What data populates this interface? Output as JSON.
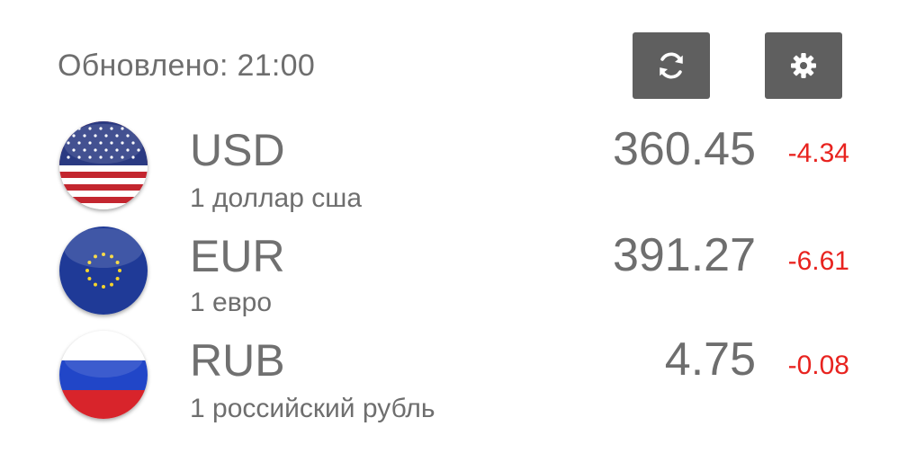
{
  "header": {
    "updated_text": "Обновлено: 21:00",
    "refresh_icon": "refresh-icon",
    "settings_icon": "gear-icon"
  },
  "colors": {
    "button_bg": "#5f5f5f",
    "negative": "#e8231f",
    "text": "#6e6e6e"
  },
  "currencies": [
    {
      "code": "USD",
      "description": "1 доллар сша",
      "rate": "360.45",
      "change": "-4.34",
      "flag": "us-flag-icon"
    },
    {
      "code": "EUR",
      "description": "1 евро",
      "rate": "391.27",
      "change": "-6.61",
      "flag": "eu-flag-icon"
    },
    {
      "code": "RUB",
      "description": "1 российский рубль",
      "rate": "4.75",
      "change": "-0.08",
      "flag": "ru-flag-icon"
    }
  ]
}
